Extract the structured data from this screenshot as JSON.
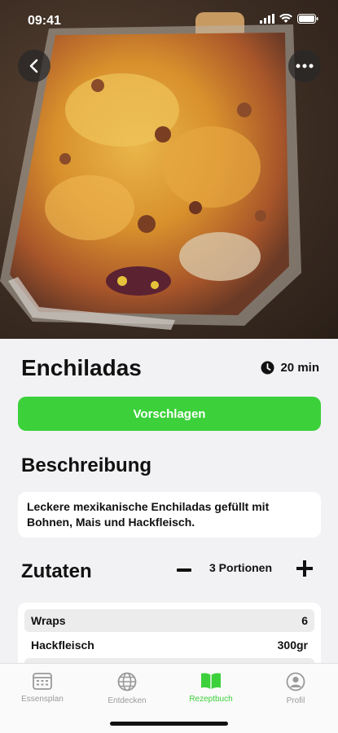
{
  "status": {
    "time": "09:41"
  },
  "recipe": {
    "title": "Enchiladas",
    "duration": "20 min",
    "suggest_label": "Vorschlagen",
    "description_heading": "Beschreibung",
    "description": "Leckere mexikanische Enchiladas gefüllt mit Bohnen, Mais und Hackfleisch.",
    "ingredients_heading": "Zutaten",
    "portions": "3 Portionen",
    "ingredients": [
      {
        "name": "Wraps",
        "amount": "6"
      },
      {
        "name": "Hackfleisch",
        "amount": "300gr"
      }
    ]
  },
  "tabs": [
    {
      "label": "Essensplan",
      "icon": "calendar-icon"
    },
    {
      "label": "Entdecken",
      "icon": "globe-icon"
    },
    {
      "label": "Rezeptbuch",
      "icon": "book-icon"
    },
    {
      "label": "Profil",
      "icon": "profile-icon"
    }
  ],
  "colors": {
    "accent": "#3cd13a",
    "background": "#f2f2f4"
  }
}
